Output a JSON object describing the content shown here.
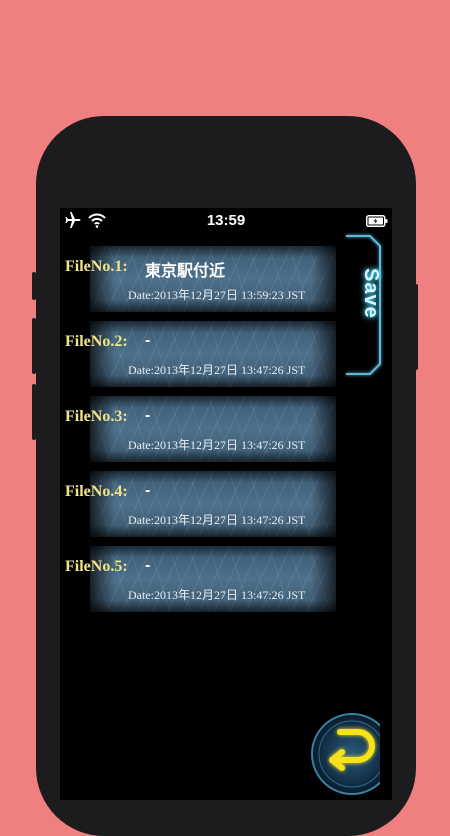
{
  "status_bar": {
    "time": "13:59",
    "icons": [
      "airplane-icon",
      "wifi-icon",
      "battery-icon"
    ]
  },
  "save_button": {
    "label": "Save"
  },
  "files": [
    {
      "label": "FileNo.1:",
      "name": "東京駅付近",
      "date": "Date:2013年12月27日 13:59:23 JST"
    },
    {
      "label": "FileNo.2:",
      "name": "-",
      "date": "Date:2013年12月27日 13:47:26 JST"
    },
    {
      "label": "FileNo.3:",
      "name": "-",
      "date": "Date:2013年12月27日 13:47:26 JST"
    },
    {
      "label": "FileNo.4:",
      "name": "-",
      "date": "Date:2013年12月27日 13:47:26 JST"
    },
    {
      "label": "FileNo.5:",
      "name": "-",
      "date": "Date:2013年12月27日 13:47:26 JST"
    }
  ],
  "colors": {
    "background": "#f08080",
    "file_label": "#f0e48a",
    "accent_glow": "#4fd8ff",
    "back_arrow": "#f5e21a"
  }
}
